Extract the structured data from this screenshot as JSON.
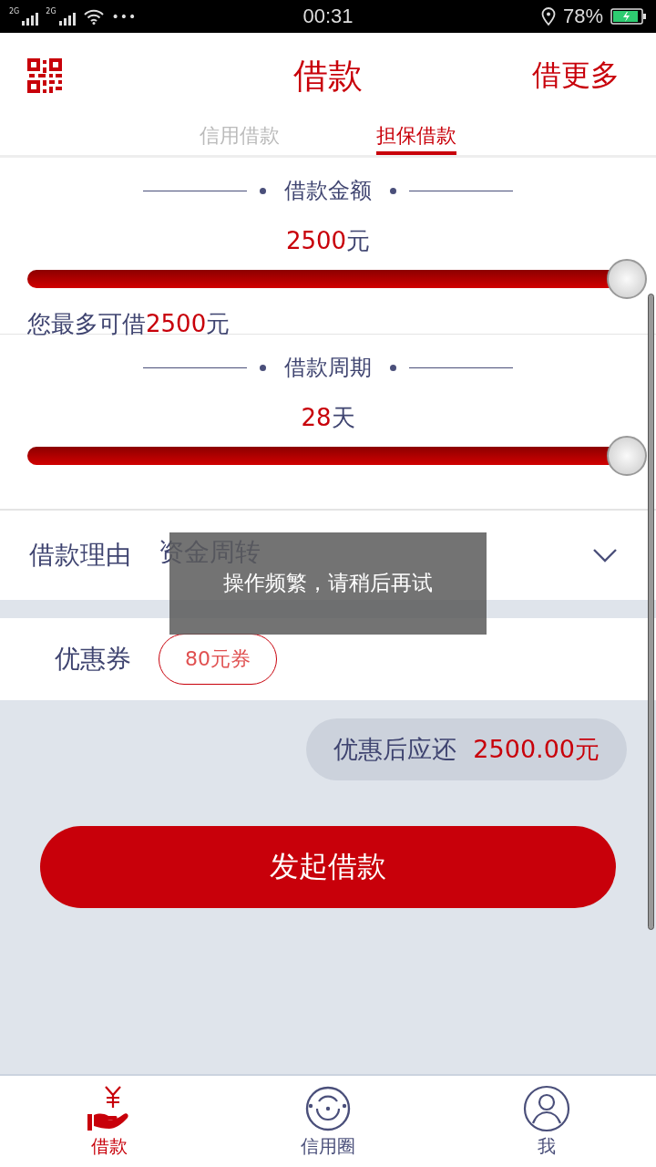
{
  "status_bar": {
    "network_1": "2G",
    "network_2": "2G",
    "dots": "•••",
    "time": "00:31",
    "battery": "78%"
  },
  "header": {
    "title": "借款",
    "action": "借更多"
  },
  "tabs": [
    {
      "label": "信用借款",
      "selected": false
    },
    {
      "label": "担保借款",
      "selected": true
    }
  ],
  "amount": {
    "heading": "借款金额",
    "value": "2500",
    "unit": "元",
    "level": 1,
    "max_prefix": "您最多可借",
    "max_value": "2500",
    "max_unit": "元"
  },
  "period": {
    "heading": "借款周期",
    "value": "28",
    "unit": "天",
    "level": 1
  },
  "reason": {
    "label": "借款理由",
    "value": "资金周转"
  },
  "toast": "操作频繁，请稍后再试",
  "coupon": {
    "label": "优惠券",
    "value": "80元券"
  },
  "repay": {
    "label": "优惠后应还",
    "value": "2500.00元"
  },
  "submit": "发起借款",
  "nav": [
    {
      "kind": "loan",
      "label": "借款",
      "selected": true
    },
    {
      "kind": "circle",
      "label": "信用圈",
      "selected": false
    },
    {
      "kind": "me",
      "label": "我",
      "selected": false
    }
  ]
}
